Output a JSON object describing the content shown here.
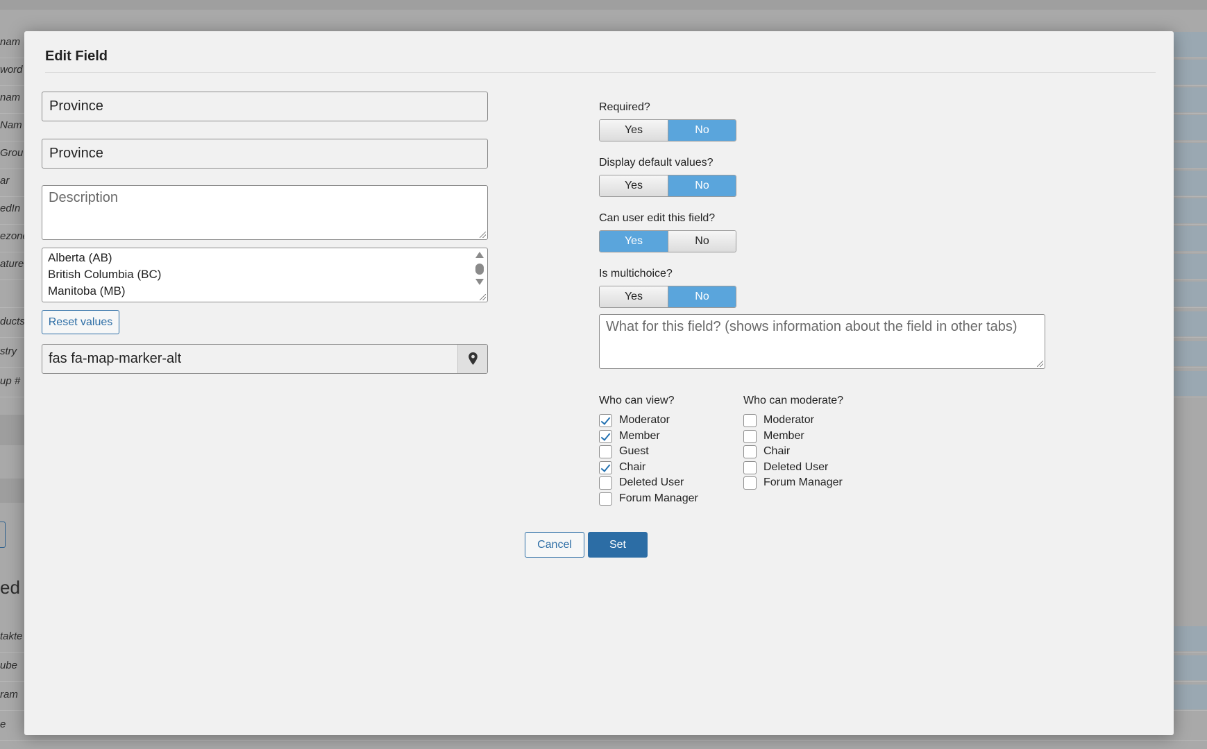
{
  "background": {
    "row_labels": [
      "nam",
      "word",
      "nam",
      "Nam",
      "Grou",
      "ar",
      "edIn",
      "ezone",
      "ature",
      "",
      "ducts",
      "stry",
      "up #",
      "",
      "",
      "",
      "",
      "",
      "",
      "takte",
      "ube",
      "ram",
      "e"
    ],
    "heading_fragment": "ed F"
  },
  "modal": {
    "title": "Edit Field",
    "field_name_value": "Province",
    "field_label_value": "Province",
    "description_placeholder": "Description",
    "values_list": [
      "Alberta (AB)",
      "British Columbia (BC)",
      "Manitoba (MB)"
    ],
    "reset_values_label": "Reset values",
    "icon_value": "fas fa-map-marker-alt",
    "icon_name": "map-marker-icon",
    "questions": [
      {
        "label": "Required?",
        "yes": "Yes",
        "no": "No",
        "selected": "No"
      },
      {
        "label": "Display default values?",
        "yes": "Yes",
        "no": "No",
        "selected": "No"
      },
      {
        "label": "Can user edit this field?",
        "yes": "Yes",
        "no": "No",
        "selected": "Yes"
      },
      {
        "label": "Is multichoice?",
        "yes": "Yes",
        "no": "No",
        "selected": "No"
      }
    ],
    "info_placeholder": "What for this field? (shows information about the field in other tabs)",
    "who_can_view": {
      "title": "Who can view?",
      "options": [
        {
          "label": "Moderator",
          "checked": true
        },
        {
          "label": "Member",
          "checked": true
        },
        {
          "label": "Guest",
          "checked": false
        },
        {
          "label": "Chair",
          "checked": true
        },
        {
          "label": "Deleted User",
          "checked": false
        },
        {
          "label": "Forum Manager",
          "checked": false
        }
      ]
    },
    "who_can_moderate": {
      "title": "Who can moderate?",
      "options": [
        {
          "label": "Moderator",
          "checked": false
        },
        {
          "label": "Member",
          "checked": false
        },
        {
          "label": "Chair",
          "checked": false
        },
        {
          "label": "Deleted User",
          "checked": false
        },
        {
          "label": "Forum Manager",
          "checked": false
        }
      ]
    },
    "cancel_label": "Cancel",
    "set_label": "Set"
  },
  "colors": {
    "accent": "#2c6da5",
    "toggle_active": "#5aa5dc",
    "checkmark": "#2271b1",
    "overlay": "#a9a9a9",
    "modal_bg": "#f1f1f1"
  }
}
